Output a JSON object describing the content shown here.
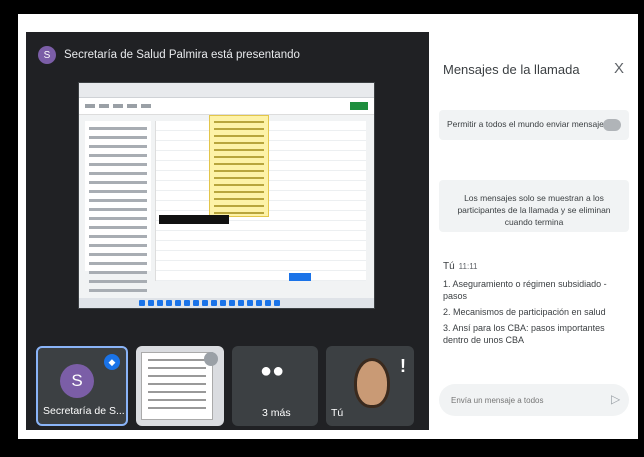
{
  "presenter": {
    "avatar_letter": "S",
    "text": "Secretaría de Salud Palmira está presentando"
  },
  "tiles": [
    {
      "avatar_letter": "S",
      "name": "Secretaría de S..."
    },
    {
      "name": ""
    },
    {
      "name": "3 más"
    },
    {
      "name": "Tú"
    }
  ],
  "panel": {
    "title": "Mensajes de la llamada",
    "close_label": "X",
    "toggle_label": "Permitir a todos el mundo enviar mensajes",
    "info": "Los mensajes solo se muestran a los participantes de la llamada y se eliminan cuando termina",
    "message": {
      "sender": "Tú",
      "time": "11:11",
      "items": [
        "1.   Aseguramiento o régimen subsidiado - pasos",
        "2.   Mecanismos de participación en salud",
        "3.   Ansí para los CBA: pasos importantes dentro de unos CBA"
      ]
    },
    "input_placeholder": "Envía un mensaje a todos"
  },
  "icons": {
    "send": "send-icon",
    "close": "close-icon",
    "pin": "pin-icon"
  },
  "colors": {
    "meet_dark": "#202124",
    "accent": "#1a73e8",
    "avatar": "#7b5ea7"
  }
}
